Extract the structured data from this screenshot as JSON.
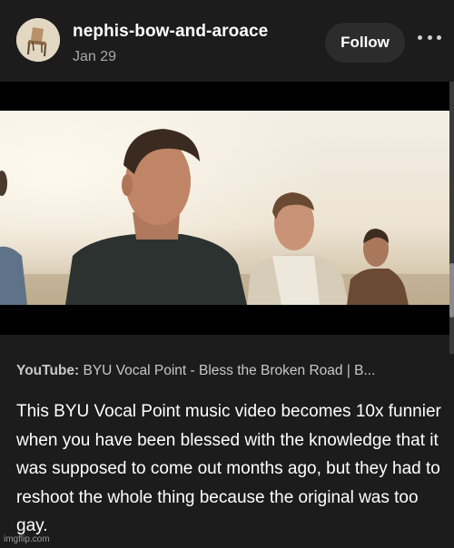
{
  "post": {
    "author": "nephis-bow-and-aroace",
    "date": "Jan 29",
    "follow_label": "Follow",
    "link": {
      "source": "YouTube:",
      "title": "BYU Vocal Point - Bless the Broken Road | B..."
    },
    "body": "This BYU Vocal Point music video becomes 10x funnier when you have been blessed with the knowledge that it was supposed to come out months ago, but they had to reshoot the whole thing because the original was too gay."
  },
  "watermark": "imgflip.com",
  "icons": {
    "avatar": "avatar-chair-image",
    "more": "more-options-icon"
  },
  "colors": {
    "background": "#1c1c1c",
    "follow_button": "#2c2c2c",
    "secondary_text": "#a8a8a8"
  }
}
